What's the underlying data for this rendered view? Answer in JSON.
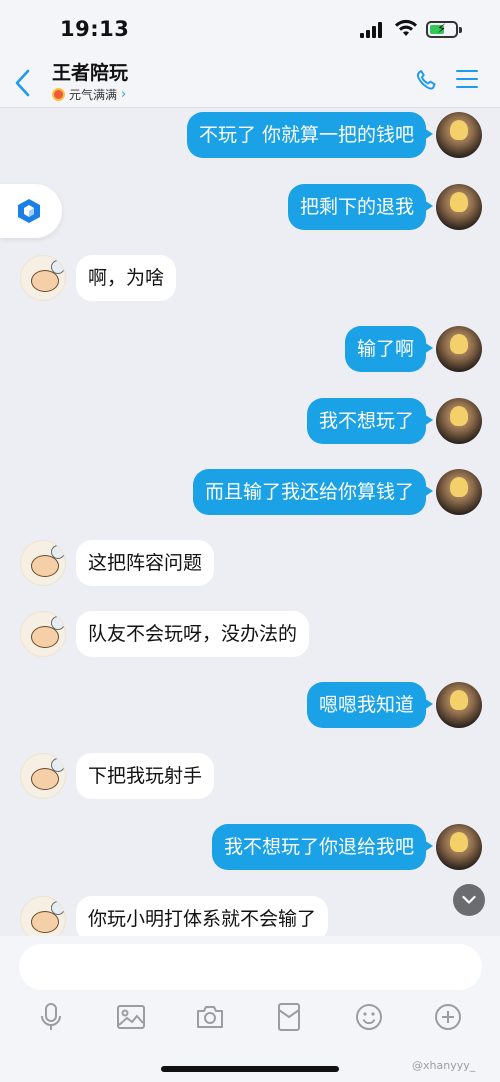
{
  "status_bar": {
    "time": "19:13"
  },
  "header": {
    "title": "王者陪玩",
    "subtitle": "元气满满",
    "back_icon": "chevron-left-icon",
    "call_icon": "phone-icon",
    "menu_icon": "menu-icon"
  },
  "messages": [
    {
      "side": "right",
      "text": "不玩了 你就算一把的钱吧"
    },
    {
      "side": "right",
      "text": "把剩下的退我"
    },
    {
      "side": "left",
      "text": "啊，为啥"
    },
    {
      "side": "right",
      "text": "输了啊"
    },
    {
      "side": "right",
      "text": "我不想玩了"
    },
    {
      "side": "right",
      "text": "而且输了我还给你算钱了"
    },
    {
      "side": "left",
      "text": "这把阵容问题"
    },
    {
      "side": "left",
      "text": "队友不会玩呀，没办法的"
    },
    {
      "side": "right",
      "text": "嗯嗯我知道"
    },
    {
      "side": "left",
      "text": "下把我玩射手"
    },
    {
      "side": "right",
      "text": "我不想玩了你退给我吧"
    },
    {
      "side": "left",
      "text": "你玩小明打体系就不会输了"
    }
  ],
  "input": {
    "value": "",
    "placeholder": ""
  },
  "toolbar": [
    "mic-icon",
    "image-icon",
    "camera-icon",
    "red-packet-icon",
    "emoji-icon",
    "plus-icon"
  ],
  "watermark": "@xhanyyy_",
  "colors": {
    "accent": "#1aa1e6",
    "background": "#edeef3"
  }
}
